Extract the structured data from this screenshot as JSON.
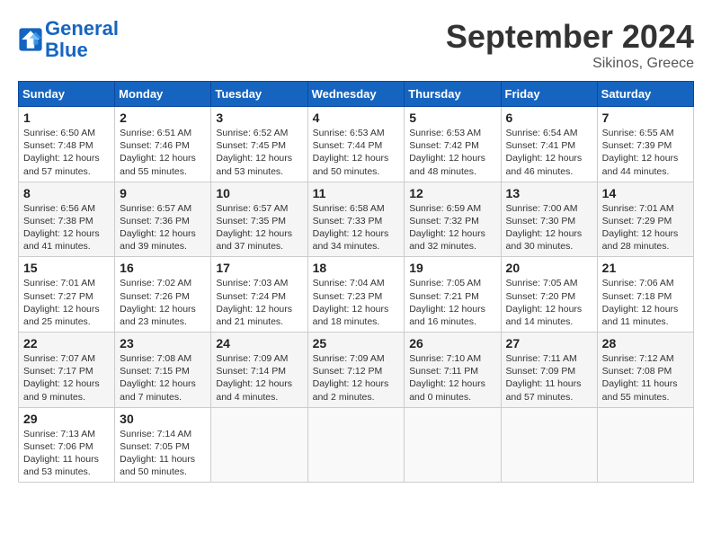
{
  "header": {
    "logo_line1": "General",
    "logo_line2": "Blue",
    "title": "September 2024",
    "subtitle": "Sikinos, Greece"
  },
  "days_of_week": [
    "Sunday",
    "Monday",
    "Tuesday",
    "Wednesday",
    "Thursday",
    "Friday",
    "Saturday"
  ],
  "weeks": [
    [
      {
        "day": "1",
        "info": "Sunrise: 6:50 AM\nSunset: 7:48 PM\nDaylight: 12 hours\nand 57 minutes."
      },
      {
        "day": "2",
        "info": "Sunrise: 6:51 AM\nSunset: 7:46 PM\nDaylight: 12 hours\nand 55 minutes."
      },
      {
        "day": "3",
        "info": "Sunrise: 6:52 AM\nSunset: 7:45 PM\nDaylight: 12 hours\nand 53 minutes."
      },
      {
        "day": "4",
        "info": "Sunrise: 6:53 AM\nSunset: 7:44 PM\nDaylight: 12 hours\nand 50 minutes."
      },
      {
        "day": "5",
        "info": "Sunrise: 6:53 AM\nSunset: 7:42 PM\nDaylight: 12 hours\nand 48 minutes."
      },
      {
        "day": "6",
        "info": "Sunrise: 6:54 AM\nSunset: 7:41 PM\nDaylight: 12 hours\nand 46 minutes."
      },
      {
        "day": "7",
        "info": "Sunrise: 6:55 AM\nSunset: 7:39 PM\nDaylight: 12 hours\nand 44 minutes."
      }
    ],
    [
      {
        "day": "8",
        "info": "Sunrise: 6:56 AM\nSunset: 7:38 PM\nDaylight: 12 hours\nand 41 minutes."
      },
      {
        "day": "9",
        "info": "Sunrise: 6:57 AM\nSunset: 7:36 PM\nDaylight: 12 hours\nand 39 minutes."
      },
      {
        "day": "10",
        "info": "Sunrise: 6:57 AM\nSunset: 7:35 PM\nDaylight: 12 hours\nand 37 minutes."
      },
      {
        "day": "11",
        "info": "Sunrise: 6:58 AM\nSunset: 7:33 PM\nDaylight: 12 hours\nand 34 minutes."
      },
      {
        "day": "12",
        "info": "Sunrise: 6:59 AM\nSunset: 7:32 PM\nDaylight: 12 hours\nand 32 minutes."
      },
      {
        "day": "13",
        "info": "Sunrise: 7:00 AM\nSunset: 7:30 PM\nDaylight: 12 hours\nand 30 minutes."
      },
      {
        "day": "14",
        "info": "Sunrise: 7:01 AM\nSunset: 7:29 PM\nDaylight: 12 hours\nand 28 minutes."
      }
    ],
    [
      {
        "day": "15",
        "info": "Sunrise: 7:01 AM\nSunset: 7:27 PM\nDaylight: 12 hours\nand 25 minutes."
      },
      {
        "day": "16",
        "info": "Sunrise: 7:02 AM\nSunset: 7:26 PM\nDaylight: 12 hours\nand 23 minutes."
      },
      {
        "day": "17",
        "info": "Sunrise: 7:03 AM\nSunset: 7:24 PM\nDaylight: 12 hours\nand 21 minutes."
      },
      {
        "day": "18",
        "info": "Sunrise: 7:04 AM\nSunset: 7:23 PM\nDaylight: 12 hours\nand 18 minutes."
      },
      {
        "day": "19",
        "info": "Sunrise: 7:05 AM\nSunset: 7:21 PM\nDaylight: 12 hours\nand 16 minutes."
      },
      {
        "day": "20",
        "info": "Sunrise: 7:05 AM\nSunset: 7:20 PM\nDaylight: 12 hours\nand 14 minutes."
      },
      {
        "day": "21",
        "info": "Sunrise: 7:06 AM\nSunset: 7:18 PM\nDaylight: 12 hours\nand 11 minutes."
      }
    ],
    [
      {
        "day": "22",
        "info": "Sunrise: 7:07 AM\nSunset: 7:17 PM\nDaylight: 12 hours\nand 9 minutes."
      },
      {
        "day": "23",
        "info": "Sunrise: 7:08 AM\nSunset: 7:15 PM\nDaylight: 12 hours\nand 7 minutes."
      },
      {
        "day": "24",
        "info": "Sunrise: 7:09 AM\nSunset: 7:14 PM\nDaylight: 12 hours\nand 4 minutes."
      },
      {
        "day": "25",
        "info": "Sunrise: 7:09 AM\nSunset: 7:12 PM\nDaylight: 12 hours\nand 2 minutes."
      },
      {
        "day": "26",
        "info": "Sunrise: 7:10 AM\nSunset: 7:11 PM\nDaylight: 12 hours\nand 0 minutes."
      },
      {
        "day": "27",
        "info": "Sunrise: 7:11 AM\nSunset: 7:09 PM\nDaylight: 11 hours\nand 57 minutes."
      },
      {
        "day": "28",
        "info": "Sunrise: 7:12 AM\nSunset: 7:08 PM\nDaylight: 11 hours\nand 55 minutes."
      }
    ],
    [
      {
        "day": "29",
        "info": "Sunrise: 7:13 AM\nSunset: 7:06 PM\nDaylight: 11 hours\nand 53 minutes."
      },
      {
        "day": "30",
        "info": "Sunrise: 7:14 AM\nSunset: 7:05 PM\nDaylight: 11 hours\nand 50 minutes."
      },
      {
        "day": "",
        "info": ""
      },
      {
        "day": "",
        "info": ""
      },
      {
        "day": "",
        "info": ""
      },
      {
        "day": "",
        "info": ""
      },
      {
        "day": "",
        "info": ""
      }
    ]
  ]
}
